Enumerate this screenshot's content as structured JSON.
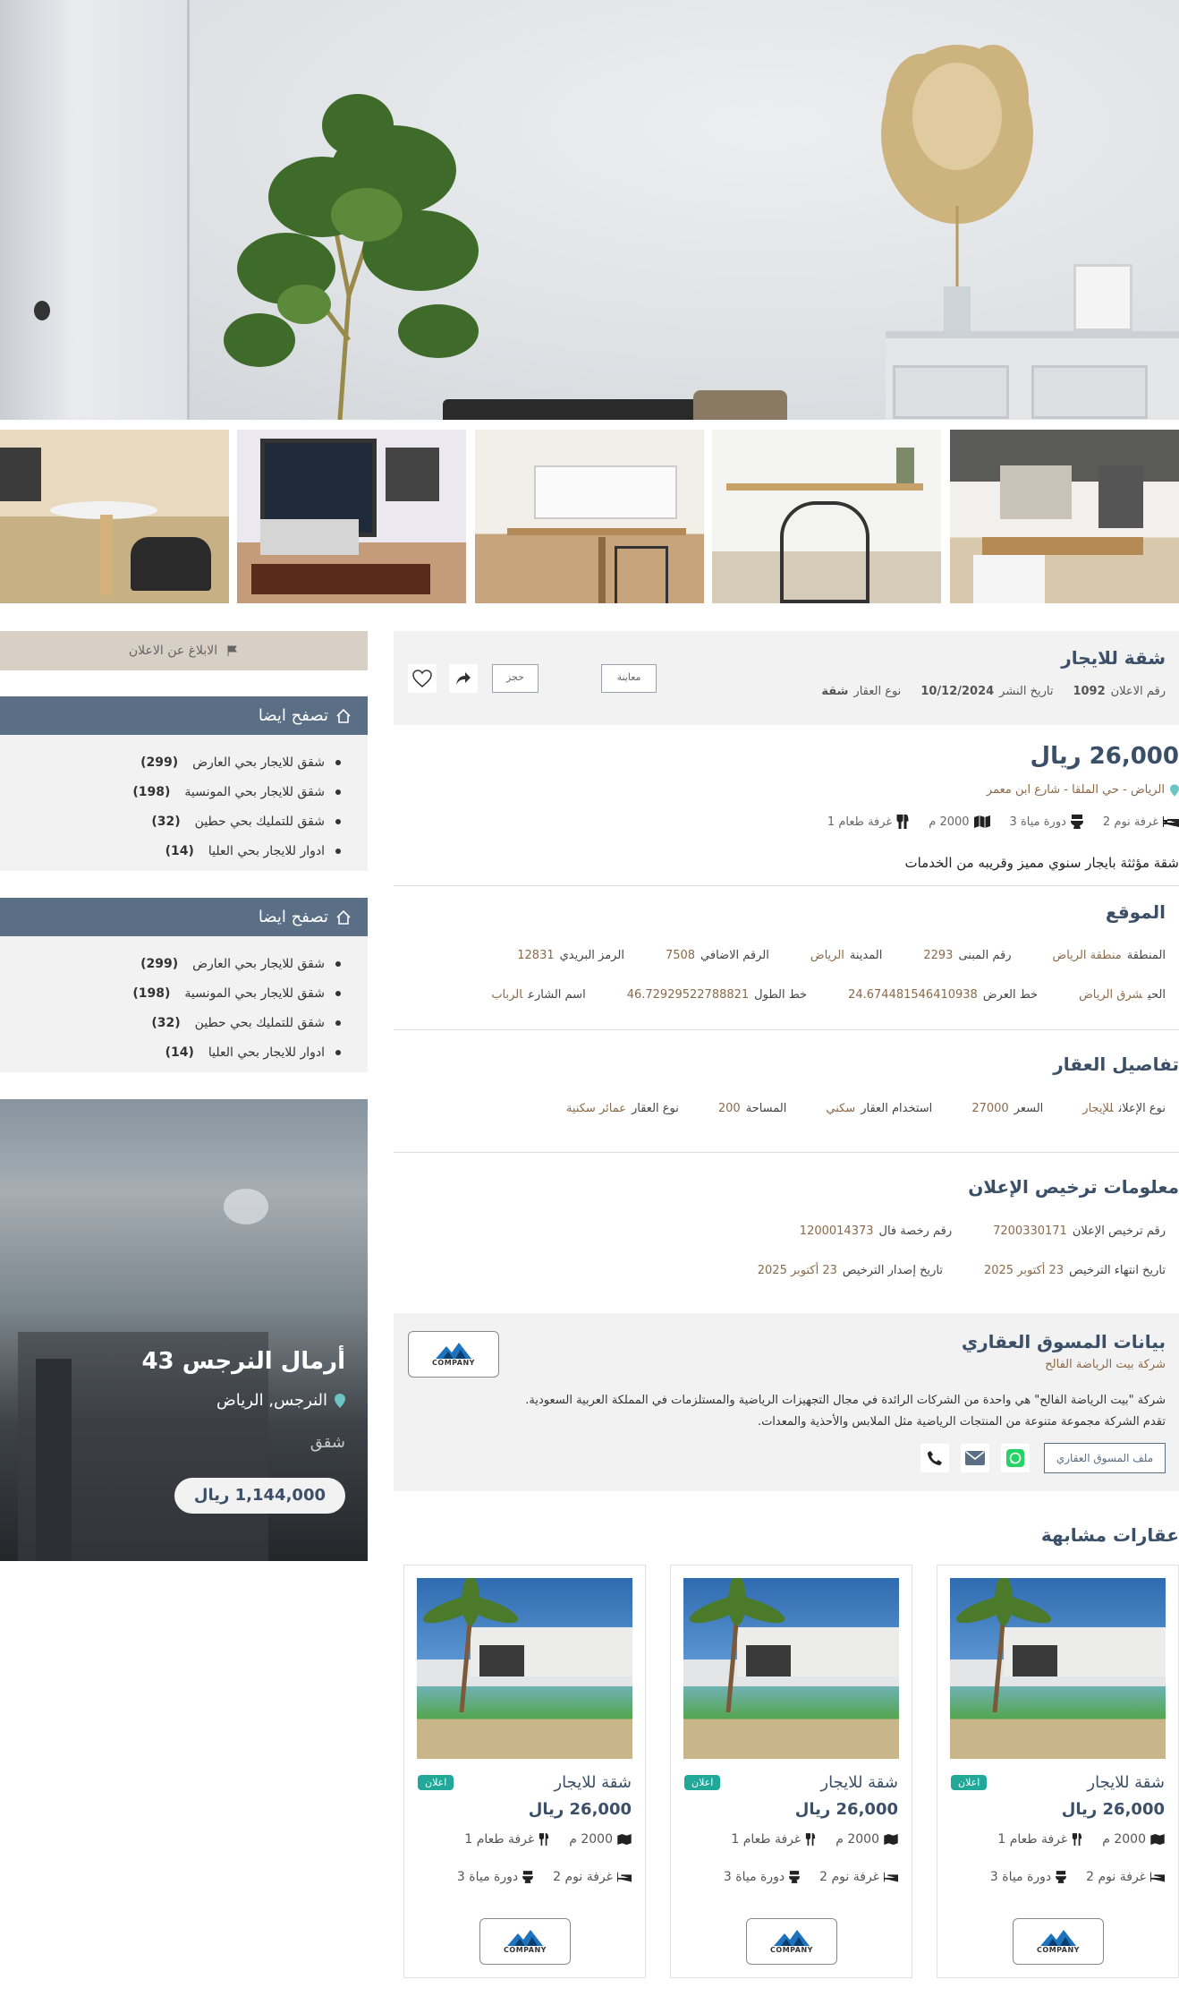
{
  "report": {
    "label": "الابلاغ عن الاعلان"
  },
  "listing": {
    "title": "شقة للايجار",
    "ad_number_label": "رقم الاعلان",
    "ad_number": "1092",
    "publish_date_label": "تاريخ النشر",
    "publish_date": "10/12/2024",
    "property_type_label": "نوع العقار",
    "property_type": "شقة",
    "preview_button": "معاينة",
    "book_button": "حجز",
    "price": "26,000 ريال",
    "location": "الرياض - حي الملقا - شارع ابن معمر",
    "features": [
      {
        "icon": "bed-icon",
        "label": "غرفة نوم 2"
      },
      {
        "icon": "toilet-icon",
        "label": "دورة مياة 3"
      },
      {
        "icon": "map-icon",
        "label": "2000 م"
      },
      {
        "icon": "utensils-icon",
        "label": "غرفة طعام 1"
      }
    ],
    "description": "شقة مؤثثة بايجار سنوي مميز وقريبه من الخدمات"
  },
  "location_section": {
    "title": "الموقع",
    "row1": [
      {
        "label": "المنطقة",
        "value": "منطقة الرياض"
      },
      {
        "label": "رقم المبنى",
        "value": "2293"
      },
      {
        "label": "المدينة",
        "value": "الرياض"
      },
      {
        "label": "الرقم الاضافي",
        "value": "7508"
      },
      {
        "label": "الرمز البريدي",
        "value": "12831"
      }
    ],
    "row2": [
      {
        "label": "الحي",
        "value": "شرق الرياض"
      },
      {
        "label": "خط العرض",
        "value": "24.674481546410938"
      },
      {
        "label": "خط الطول",
        "value": "46.72929522788821"
      },
      {
        "label": "اسم الشارع",
        "value": "الرباب"
      }
    ]
  },
  "details_section": {
    "title": "تفاصيل العقار",
    "items": [
      {
        "label": "نوع الإعلان",
        "value": "للإيجار"
      },
      {
        "label": "السعر",
        "value": "27000"
      },
      {
        "label": "استخدام العقار",
        "value": "سكني"
      },
      {
        "label": "المساحة",
        "value": "200"
      },
      {
        "label": "نوع العقار",
        "value": "عمائر سكنية"
      }
    ]
  },
  "license_section": {
    "title": "معلومات ترخيص الإعلان",
    "row1": [
      {
        "label": "رقم ترخيص الإعلان",
        "value": "7200330171"
      },
      {
        "label": "رقم رخصة فال",
        "value": "1200014373"
      }
    ],
    "row2": [
      {
        "label": "تاريخ انتهاء الترخيص",
        "value": "23 أكتوبر 2025"
      },
      {
        "label": "تاريخ إصدار الترخيص",
        "value": "23 أكتوبر 2025"
      }
    ]
  },
  "marketer": {
    "title": "بيانات المسوق العقاري",
    "company_name": "شركة بيت الرياضة الفالح",
    "description_line1": "شركة \"بيت الرياضة الفالح\" هي واحدة من الشركات الرائدة في مجال التجهيزات الرياضية والمستلزمات في المملكة العربية السعودية.",
    "description_line2": "تقدم الشركة مجموعة متنوعة من المنتجات الرياضية مثل الملابس والأحذية والمعدات.",
    "profile_button": "ملف المسوق العقاري",
    "logo_text": "COMPANY"
  },
  "browse": {
    "title": "تصفح ايضا",
    "items": [
      {
        "label": "شقق للايجار بحي العارض",
        "count": "(299)"
      },
      {
        "label": "شقق للايجار بحي المونسية",
        "count": "(198)"
      },
      {
        "label": "شقق للتمليك بحي حطين",
        "count": "(32)"
      },
      {
        "label": "ادوار للايجار بحي العليا",
        "count": "(14)"
      }
    ]
  },
  "promo": {
    "title": "أرمال النرجس 43",
    "location": "النرجس, الرياض",
    "type": "شقق",
    "price": "1,144,000 ريال"
  },
  "similar": {
    "title": "عقارات مشابهة",
    "cards": [
      {
        "title": "شقة للايجار",
        "price": "26,000 ريال",
        "badge": "اعلان",
        "area": "2000 م",
        "dining": "غرفة طعام 1",
        "bedrooms": "غرفة نوم 2",
        "bathrooms": "دورة مياة 3",
        "logo": "COMPANY"
      },
      {
        "title": "شقة للايجار",
        "price": "26,000 ريال",
        "badge": "اعلان",
        "area": "2000 م",
        "dining": "غرفة طعام 1",
        "bedrooms": "غرفة نوم 2",
        "bathrooms": "دورة مياة 3",
        "logo": "COMPANY"
      },
      {
        "title": "شقة للايجار",
        "price": "26,000 ريال",
        "badge": "اعلان",
        "area": "2000 م",
        "dining": "غرفة طعام 1",
        "bedrooms": "غرفة نوم 2",
        "bathrooms": "دورة مياة 3",
        "logo": "COMPANY"
      }
    ]
  },
  "colors": {
    "accent": "#3b5068",
    "sidebar_header": "#5a6f86",
    "badge": "#22a898",
    "whatsapp": "#25d366"
  }
}
